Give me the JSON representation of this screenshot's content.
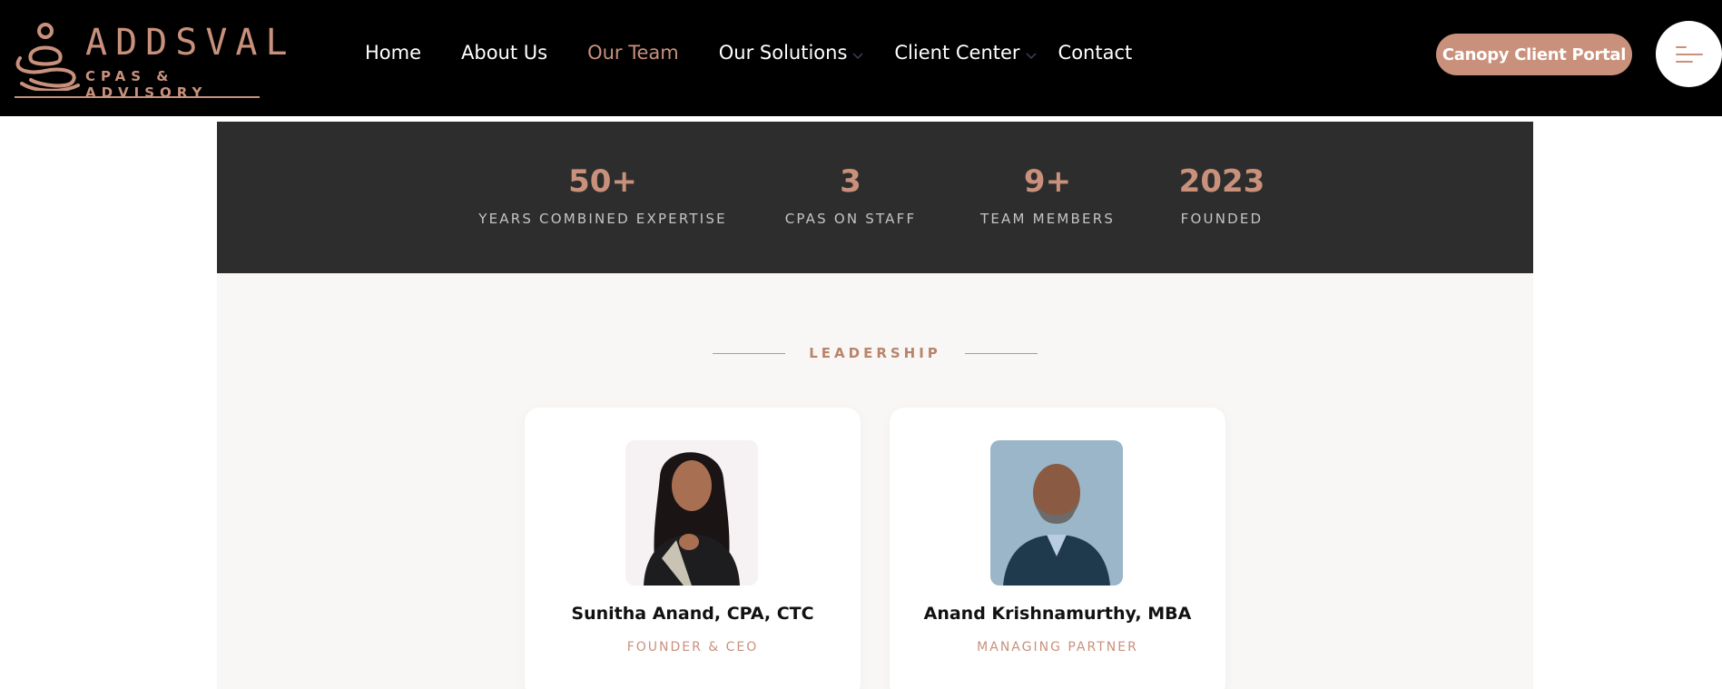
{
  "brand": {
    "name": "ADDSVAL",
    "tagline": "CPAS & ADVISORY",
    "accent_color": "#c9917c"
  },
  "nav": {
    "items": [
      {
        "label": "Home"
      },
      {
        "label": "About Us"
      },
      {
        "label": "Our Team",
        "active": true
      },
      {
        "label": "Our Solutions",
        "has_dropdown": true
      },
      {
        "label": "Client Center",
        "has_dropdown": true
      },
      {
        "label": "Contact"
      }
    ],
    "portal_button": "Canopy Client Portal",
    "menu_icon": "hamburger-menu-icon"
  },
  "stats": [
    {
      "value": "50+",
      "label": "YEARS COMBINED EXPERTISE"
    },
    {
      "value": "3",
      "label": "CPAS ON STAFF"
    },
    {
      "value": "9+",
      "label": "TEAM MEMBERS"
    },
    {
      "value": "2023",
      "label": "FOUNDED"
    }
  ],
  "leadership": {
    "heading": "LEADERSHIP",
    "members": [
      {
        "name": "Sunitha Anand, CPA, CTC",
        "role": "FOUNDER & CEO"
      },
      {
        "name": "Anand Krishnamurthy, MBA",
        "role": "MANAGING PARTNER"
      }
    ]
  }
}
